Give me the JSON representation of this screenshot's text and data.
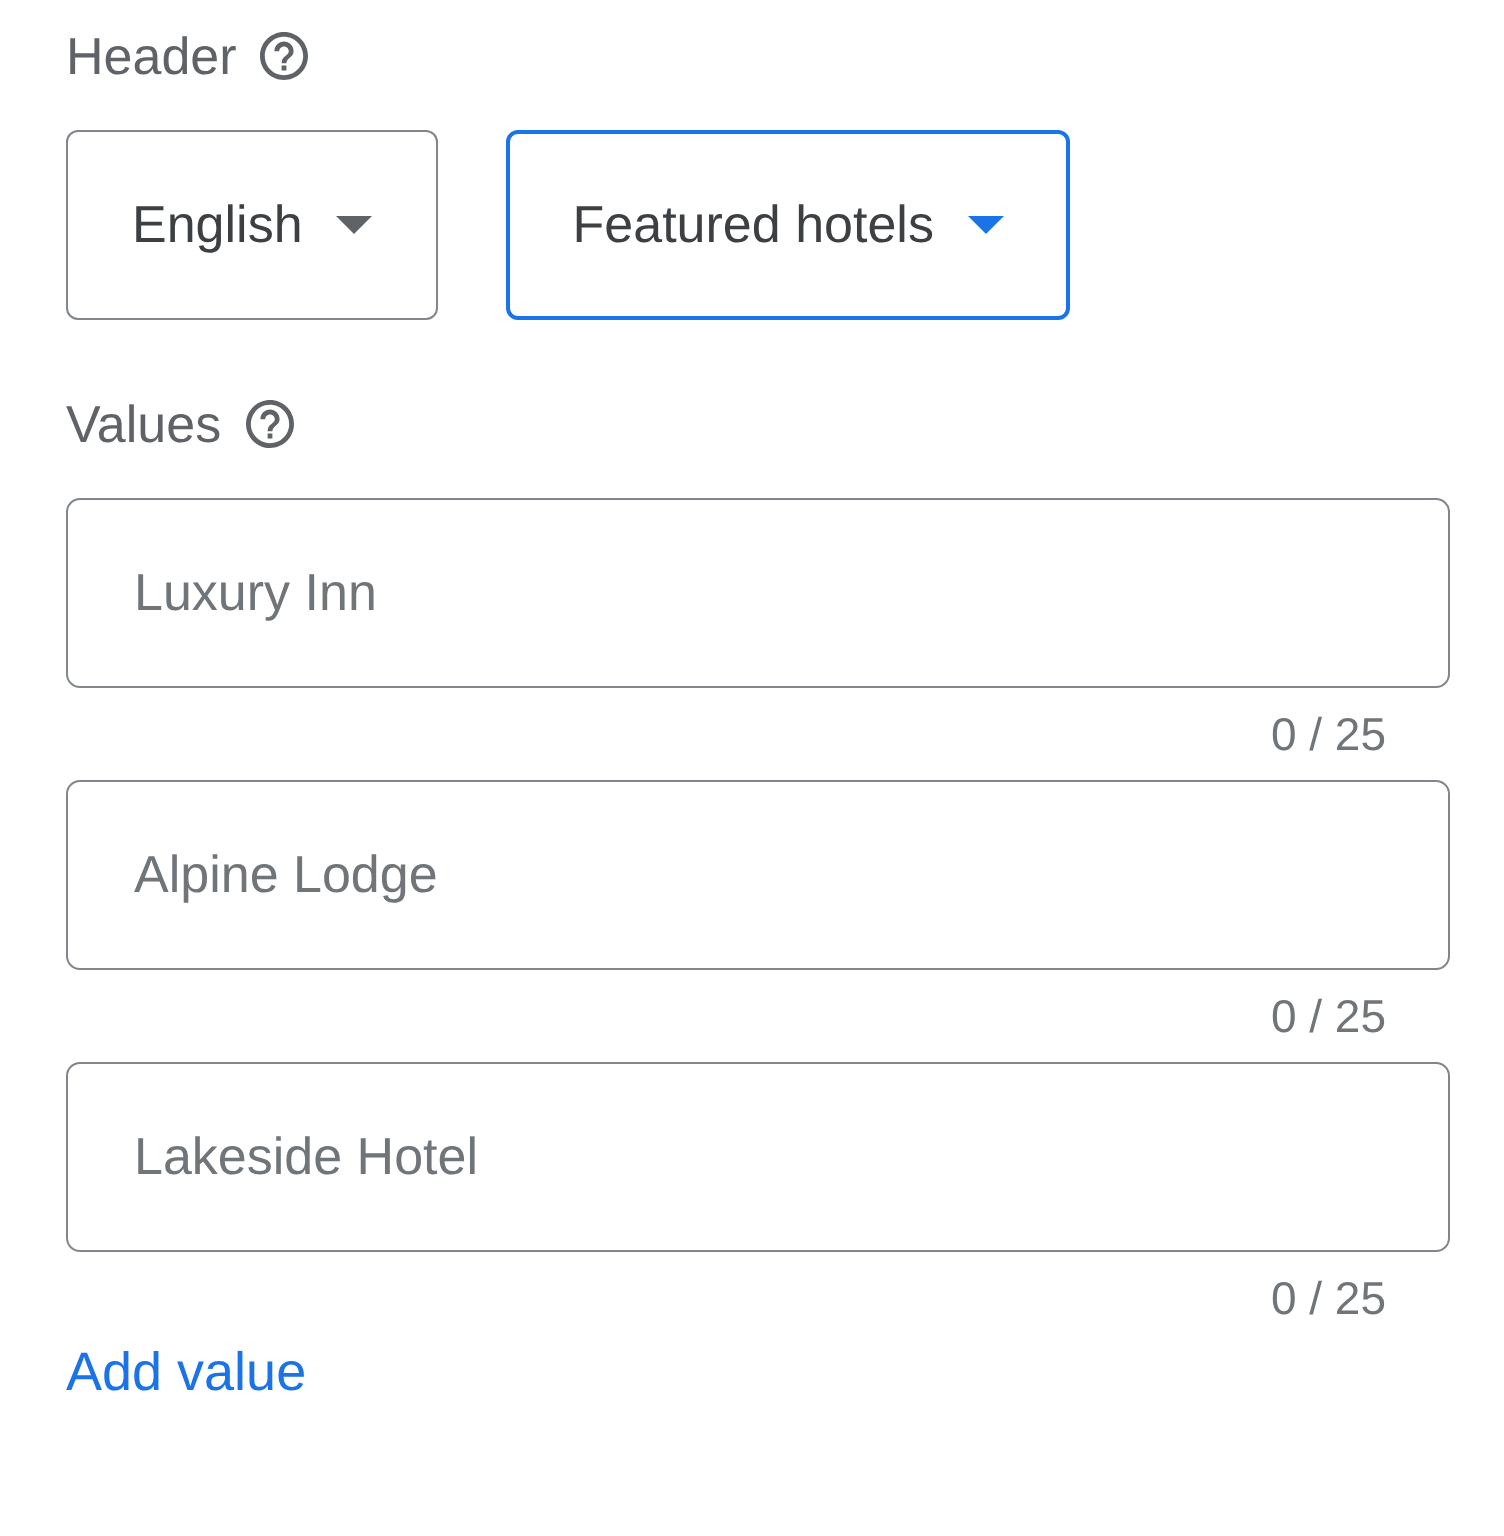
{
  "header": {
    "label": "Header",
    "dropdowns": [
      {
        "value": "English",
        "focused": false
      },
      {
        "value": "Featured hotels",
        "focused": true
      }
    ]
  },
  "values": {
    "label": "Values",
    "fields": [
      {
        "placeholder": "Luxury Inn",
        "counter": "0 / 25"
      },
      {
        "placeholder": "Alpine Lodge",
        "counter": "0 / 25"
      },
      {
        "placeholder": "Lakeside Hotel",
        "counter": "0 / 25"
      }
    ]
  },
  "add_button": {
    "label": "Add value"
  }
}
